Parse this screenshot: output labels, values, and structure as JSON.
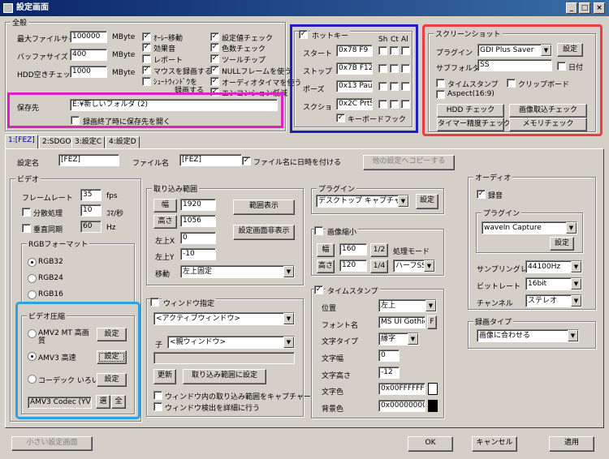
{
  "window": {
    "title": "設定画面",
    "min": "_",
    "max": "□",
    "close": "×"
  },
  "general": {
    "title": "全般",
    "max_file_size_label": "最大ファイルサイズ",
    "max_file_size": "100000",
    "max_file_unit": "MByte",
    "buffer_size_label": "バッファサイズ",
    "buffer_size": "400",
    "buffer_unit": "MByte",
    "hdd_check_label": "HDD空きチェック",
    "hdd_check": "1000",
    "hdd_unit": "MByte",
    "checks_col1": [
      "ｵｰﾚｰ移動",
      "効果音",
      "レポート",
      "マウスを録画する",
      "ｼｭｰﾄｳｨﾝﾄﾞｳを"
    ],
    "checks_col1_sub": "録画する",
    "checks_col2": [
      "設定値チェック",
      "色数チェック",
      "ツールチップ",
      "NULLフレームを使う",
      "オーディオタイマを使う",
      "エンコンション低減"
    ],
    "save_dest_label": "保存先",
    "save_dest": "E:¥新しいフォルダ (2)",
    "open_after_label": "録画終了時に保存先を開く"
  },
  "hotkeys": {
    "title": "ホットキー",
    "cols": [
      "Sh",
      "Ct",
      "Al"
    ],
    "rows": [
      {
        "label": "スタート",
        "value": "0x78 F9"
      },
      {
        "label": "ストップ",
        "value": "0x7B F12"
      },
      {
        "label": "ポーズ",
        "value": "0x13 Paus"
      },
      {
        "label": "スクショ",
        "value": "0x2C PrtS"
      }
    ],
    "keyboard_hook": "キーボードフック"
  },
  "screenshot": {
    "title": "スクリーンショット",
    "plugin_label": "プラグイン",
    "plugin_value": "GDI Plus Saver",
    "settings": "設定",
    "subfolder_label": "サブフォルダ",
    "subfolder_value": "SS",
    "date_label": "日付",
    "timestamp": "タイムスタンプ",
    "clipboard": "クリップボード",
    "aspect": "Aspect(16:9)",
    "hdd_check": "HDD チェック",
    "capture_check": "画像取込チェック",
    "timer_check": "タイマー精度チェック",
    "memory_check": "メモリチェック"
  },
  "tabs": [
    "1:[FEZ]",
    "2:SDGO",
    "3:設定C",
    "4:設定D"
  ],
  "profile": {
    "name_label": "設定名",
    "name_value": "[FEZ]",
    "file_label": "ファイル名",
    "file_value": "[FEZ]",
    "date_in_name": "ファイル名に日時を付ける",
    "copy_button": "他の設定へコピーする"
  },
  "video": {
    "title": "ビデオ",
    "framerate_label": "フレームレート",
    "framerate": "35",
    "fps": "fps",
    "split_label": "分散処理",
    "split": "10",
    "split_unit": "ｺﾏ/秒",
    "vsync_label": "垂直同期",
    "vsync": "60",
    "hz": "Hz",
    "rgb_title": "RGBフォーマット",
    "rgb_options": [
      "RGB32",
      "RGB24",
      "RGB16"
    ],
    "comp_title": "ビデオ圧縮",
    "comp_options": [
      "AMV2 MT 高画質",
      "AMV3 高速",
      "コーデック いろいろ"
    ],
    "settings": "設定",
    "codec_value": "AMV3 Codec (YV",
    "sel": "選",
    "all": "全"
  },
  "capture_range": {
    "title": "取り込み範囲",
    "width_label": "幅",
    "width": "1920",
    "height_label": "高さ",
    "height": "1056",
    "left_label": "左上X",
    "left": "0",
    "top_label": "左上Y",
    "top": "-10",
    "move_label": "移動",
    "move_value": "左上固定",
    "show_range": "範囲表示",
    "hide_settings": "設定画面非表示"
  },
  "window_spec": {
    "title": "ウィンドウ指定",
    "active": "<アクティブウィンドウ>",
    "child_label": "子",
    "child_value": "<親ウィンドウ>",
    "refresh": "更新",
    "set_capture": "取り込み範囲に設定",
    "opt1": "ウィンドウ内の取り込み範囲をキャプチャー",
    "opt2": "ウィンドウ検出を詳細に行う"
  },
  "plugin": {
    "title": "プラグイン",
    "value": "デスクトップ キャプチャー",
    "settings": "設定"
  },
  "shrink": {
    "title": "画像縮小",
    "width_label": "幅",
    "width": "160",
    "half": "1/2",
    "mode_label": "処理モード",
    "height_label": "高さ",
    "height": "120",
    "quarter": "1/4",
    "mode_value": "ハーフSSE"
  },
  "timestamp": {
    "title": "タイムスタンプ",
    "pos_label": "位置",
    "pos_value": "左上",
    "font_label": "フォント名",
    "font_value": "MS UI Gothic",
    "font_btn": "F",
    "style_label": "文字タイプ",
    "style_value": "縁字",
    "width_label": "文字幅",
    "width": "0",
    "height_label": "文字高さ",
    "height": "-12",
    "color_label": "文字色",
    "color_value": "0x00FFFFFF",
    "bg_label": "背景色",
    "bg_value": "0x00000000",
    "text_color": "#ffffff",
    "bg_color": "#000000"
  },
  "audio": {
    "title": "オーディオ",
    "record": "録音",
    "plugin_title": "プラグイン",
    "plugin_value": "waveIn Capture",
    "settings": "設定",
    "rate_label": "サンプリングレート",
    "rate_value": "44100Hz",
    "bits_label": "ビットレート",
    "bits_value": "16bit",
    "channel_label": "チャンネル",
    "channel_value": "ステレオ"
  },
  "record_type": {
    "title": "録画タイプ",
    "value": "画像に合わせる"
  },
  "bottom": {
    "small": "小さい設定画面",
    "ok": "OK",
    "cancel": "キャンセル",
    "apply": "適用"
  },
  "highlights": {
    "magenta": "#e020c0",
    "blue": "#2020c0",
    "red": "#e84040",
    "cyan": "#30a0e0"
  }
}
